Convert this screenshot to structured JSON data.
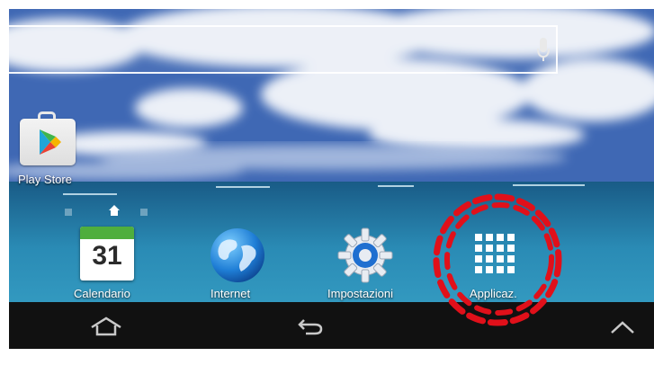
{
  "home_screen": {
    "shortcuts": [
      {
        "label": "Play Store",
        "icon": "play-store-icon"
      }
    ],
    "dock": [
      {
        "label": "Calendario",
        "icon": "calendar-icon",
        "date_number": "31"
      },
      {
        "label": "Internet",
        "icon": "globe-icon"
      },
      {
        "label": "Impostazioni",
        "icon": "gear-icon"
      },
      {
        "label": "Applicaz.",
        "icon": "app-drawer-icon"
      }
    ]
  },
  "navigation_bar": {
    "buttons": [
      {
        "icon": "home-icon"
      },
      {
        "icon": "back-icon"
      },
      {
        "icon": "chevron-up-icon"
      }
    ]
  },
  "annotation": {
    "color": "#e0101a",
    "shape": "dashed-ellipse"
  },
  "colors": {
    "calendar_green": "#4fae3d",
    "nav_bar": "#111111",
    "gear_blue": "#1f6fd0"
  }
}
